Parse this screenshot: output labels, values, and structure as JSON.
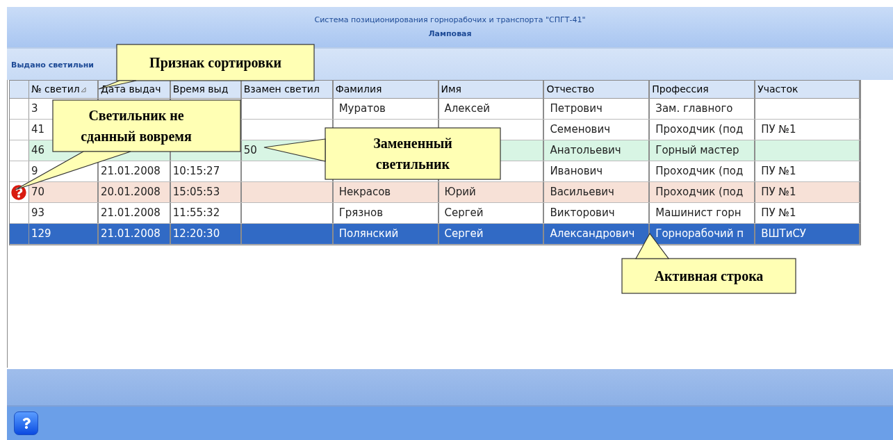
{
  "window": {
    "title": "Система позиционирования горнорабочих и транспорта \"СПГТ-41\"",
    "subtitle": "Ламповая"
  },
  "section_title": "Выдано светильни",
  "table": {
    "columns": [
      {
        "label": "№ светил",
        "sorted": true
      },
      {
        "label": "Дата выдач",
        "sorted": false
      },
      {
        "label": "Время выд",
        "sorted": false
      },
      {
        "label": "Взамен светил",
        "sorted": false
      },
      {
        "label": "Фамилия",
        "sorted": false
      },
      {
        "label": "Имя",
        "sorted": false
      },
      {
        "label": "Отчество",
        "sorted": false
      },
      {
        "label": "Профессия",
        "sorted": false
      },
      {
        "label": "Участок",
        "sorted": false
      }
    ],
    "rows": [
      {
        "kind": "normal",
        "selected": false,
        "cells": [
          "3",
          null,
          null,
          null,
          "Муратов",
          "Алексей",
          "Петрович",
          "Зам. главного",
          null
        ]
      },
      {
        "kind": "normal",
        "selected": false,
        "cells": [
          "41",
          null,
          null,
          null,
          null,
          null,
          "Семенович",
          "Проходчик (под",
          "ПУ №1"
        ]
      },
      {
        "kind": "replaced",
        "selected": false,
        "cells": [
          "46",
          null,
          null,
          "50",
          null,
          null,
          "Анатольевич",
          "Горный мастер",
          null
        ]
      },
      {
        "kind": "normal",
        "selected": false,
        "cells": [
          "9",
          "21.01.2008",
          "10:15:27",
          null,
          null,
          null,
          "Иванович",
          "Проходчик (под",
          "ПУ №1"
        ]
      },
      {
        "kind": "overdue",
        "selected": false,
        "cells": [
          "70",
          "20.01.2008",
          "15:05:53",
          null,
          "Некрасов",
          "Юрий",
          "Васильевич",
          "Проходчик (под",
          "ПУ №1"
        ]
      },
      {
        "kind": "normal",
        "selected": false,
        "cells": [
          "93",
          "21.01.2008",
          "11:55:32",
          null,
          "Грязнов",
          "Сергей",
          "Викторович",
          "Машинист горн",
          "ПУ №1"
        ]
      },
      {
        "kind": "normal",
        "selected": true,
        "cells": [
          "129",
          "21.01.2008",
          "12:20:30",
          null,
          "Полянский",
          "Сергей",
          "Александрович",
          "Горнорабочий п",
          "ВШТиСУ"
        ]
      }
    ]
  },
  "callouts": [
    {
      "text": "Признак сортировки"
    },
    {
      "text": "Светильник не сданный вовремя"
    },
    {
      "text": "Замененный светильник"
    },
    {
      "text": "Активная строка"
    }
  ]
}
